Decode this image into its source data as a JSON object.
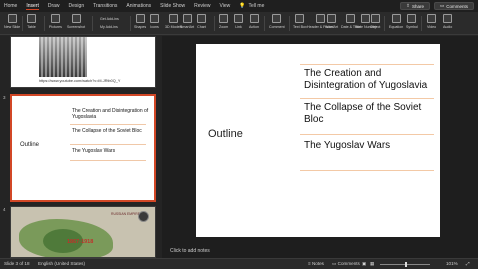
{
  "tabs": [
    "Home",
    "Insert",
    "Draw",
    "Design",
    "Transitions",
    "Animations",
    "Slide Show",
    "Review",
    "View"
  ],
  "active_tab": "Insert",
  "tell_me": "Tell me",
  "share_label": "Share",
  "comments_label": "Comments",
  "ribbon": {
    "new_slide": "New Slide",
    "table": "Table",
    "pictures": "Pictures",
    "screenshot": "Screenshot",
    "get_addins": "Get Add-ins",
    "my_addins": "My Add-ins",
    "shapes": "Shapes",
    "icons": "Icons",
    "models_3d": "3D Models",
    "smartart": "SmartArt",
    "chart": "Chart",
    "zoom": "Zoom",
    "link": "Link",
    "action": "Action",
    "comment": "Comment",
    "text_box": "Text Box",
    "header_footer": "Header & Footer",
    "wordart": "WordArt",
    "date_time": "Date & Time",
    "slide_number": "Slide Number",
    "object": "Object",
    "equation": "Equation",
    "symbol": "Symbol",
    "video": "Video",
    "audio": "Audio"
  },
  "sidebar": {
    "slide_numbers": [
      "3",
      "4"
    ],
    "thumb1_url": "https://www.youtube.com/watch?v=M-JRtb0Q_Y",
    "thumb3": {
      "outline": "Outline",
      "items": [
        "The Creation and Disintegration of Yugoslavia",
        "The Collapse of the Soviet Bloc",
        "The Yugoslav Wars"
      ]
    },
    "thumb4": {
      "date": "1867-1918",
      "map_label": "RUSSIAN EMPIRE"
    }
  },
  "slide": {
    "title": "Outline",
    "items": [
      "The Creation and Disintegration of Yugoslavia",
      "The Collapse of the Soviet Bloc",
      "The Yugoslav Wars"
    ]
  },
  "notes_placeholder": "Click to add notes",
  "status": {
    "slide_info": "Slide 3 of 18",
    "language": "English (United States)",
    "notes": "Notes",
    "comments": "Comments",
    "zoom": "101%"
  }
}
